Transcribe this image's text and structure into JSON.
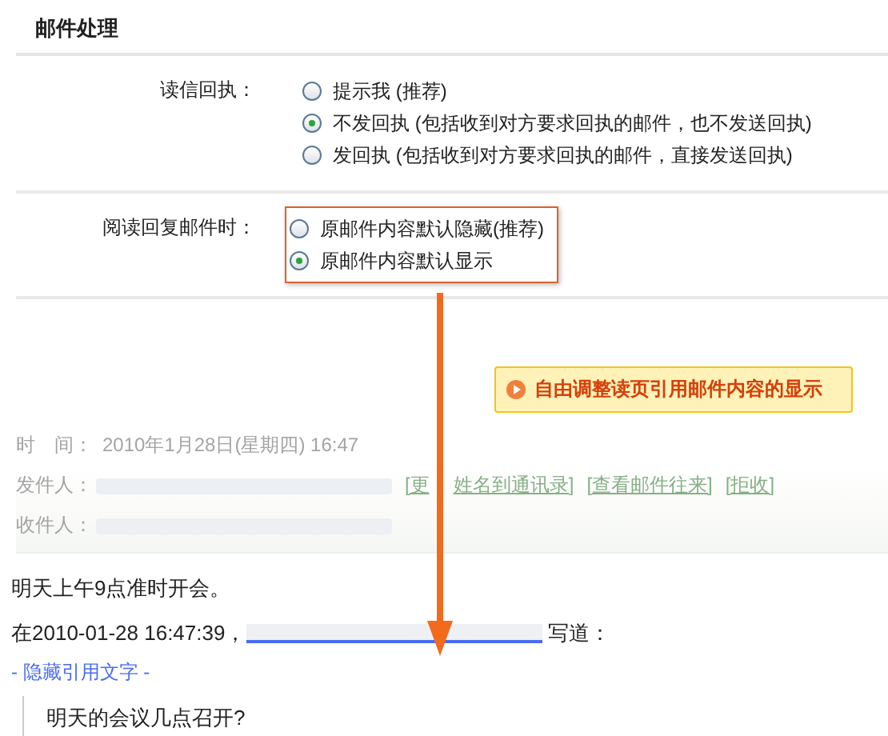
{
  "title": "邮件处理",
  "settings": [
    {
      "label": "读信回执：",
      "highlighted": false,
      "options": [
        {
          "text": "提示我 (推荐)",
          "selected": false
        },
        {
          "text": "不发回执 (包括收到对方要求回执的邮件，也不发送回执)",
          "selected": true
        },
        {
          "text": "发回执 (包括收到对方要求回执的邮件，直接发送回执)",
          "selected": false
        }
      ]
    },
    {
      "label": "阅读回复邮件时：",
      "highlighted": true,
      "options": [
        {
          "text": "原邮件内容默认隐藏(推荐)",
          "selected": false
        },
        {
          "text": "原邮件内容默认显示",
          "selected": true
        }
      ]
    }
  ],
  "notice": "自由调整读页引用邮件内容的显示",
  "header": {
    "time_label": "时　间：",
    "time": "2010年1月28日(星期四) 16:47",
    "sender_label": "发件人：",
    "links": [
      [
        "[更",
        "姓名到通讯录]"
      ],
      [
        "[查看邮件往来]"
      ],
      [
        "[拒收]"
      ]
    ],
    "receiver_label": "收件人："
  },
  "body": {
    "text": "明天上午9点准时开会。",
    "quote_intro": "在2010-01-28 16:47:39，",
    "quote_outro": "写道：",
    "toggle": "- 隐藏引用文字 -",
    "quote": "明天的会议几点召开?"
  }
}
